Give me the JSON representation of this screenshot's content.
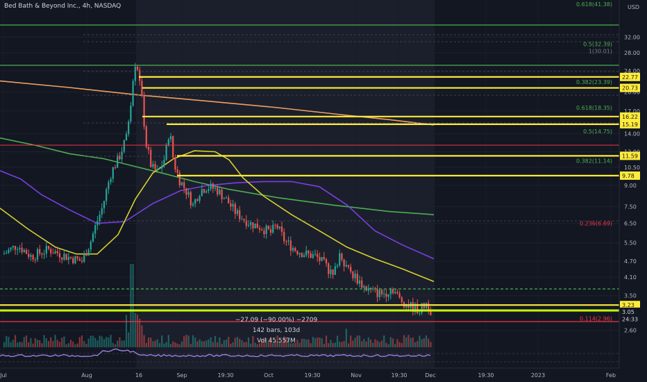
{
  "header": {
    "title": "Bed Bath & Beyond Inc., 4h, NASDAQ",
    "currency": "USD"
  },
  "chart_data": {
    "type": "candlestick",
    "ylim": [
      2.25,
      44
    ],
    "log_scale": true,
    "y_ticks": [
      2.6,
      3.05,
      3.5,
      4.1,
      4.7,
      5.5,
      6.5,
      7.5,
      9.0,
      10.5,
      12.0,
      14.0,
      17.0,
      20.0,
      24.0,
      28.0,
      32.0
    ],
    "x_ticks": [
      "Jul",
      "Aug",
      "16",
      "Sep",
      "19:30",
      "Oct",
      "19:30",
      "Nov",
      "19:30",
      "Dec",
      "19:30",
      "2023",
      "Feb"
    ],
    "price_labels": [
      {
        "value": 22.77,
        "text": "22.77",
        "bg": "#ffeb3b"
      },
      {
        "value": 20.73,
        "text": "20.73",
        "bg": "#ffeb3b"
      },
      {
        "value": 16.22,
        "text": "16.22",
        "bg": "#ffeb3b"
      },
      {
        "value": 15.19,
        "text": "15.19",
        "bg": "#ffeb3b"
      },
      {
        "value": 11.59,
        "text": "11.59",
        "bg": "#ffeb3b"
      },
      {
        "value": 9.78,
        "text": "9.78",
        "bg": "#ffeb3b"
      },
      {
        "value": 3.23,
        "text": "3.23",
        "bg": "#ffeb3b"
      },
      {
        "value": 3.05,
        "text": "3.05",
        "bg": "#131722"
      },
      {
        "value": 2.86,
        "text": "24:33",
        "bg": "#131722"
      }
    ],
    "fib_levels": [
      {
        "text": "0.618(41.38)",
        "value": 42.5,
        "color": "#4caf50"
      },
      {
        "text": "0.5(32.39)",
        "value": 30.2,
        "color": "#4caf50"
      },
      {
        "text": "1(30.01)",
        "value": 28.4,
        "color": "#787b86"
      },
      {
        "text": "0.382(23.39)",
        "value": 21.8,
        "color": "#4caf50"
      },
      {
        "text": "0.618(18.35)",
        "value": 17.5,
        "color": "#4caf50"
      },
      {
        "text": "0.5(14.75)",
        "value": 14.3,
        "color": "#4caf50"
      },
      {
        "text": "0.382(11.14)",
        "value": 11.1,
        "color": "#4caf50"
      },
      {
        "text": "0.236(6.69)",
        "value": 6.5,
        "color": "#f23645"
      },
      {
        "text": "0.114(2.96)",
        "value": 2.88,
        "color": "#f23645"
      }
    ],
    "measure": {
      "line1": "−27.09 (−90.00%) −2709",
      "line2": "142 bars, 103d",
      "line3": "Vol 45.557M"
    },
    "colors": {
      "up": "#26a69a",
      "down": "#ef5350",
      "yellow": "#ffeb3b",
      "ma_orange": "#f0a060",
      "ma_green": "#4caf50",
      "ma_purple": "#7b3fe4",
      "ma_yellow": "#d8d030",
      "red_line": "#f23645",
      "rsi": "#9c7fe0"
    }
  }
}
